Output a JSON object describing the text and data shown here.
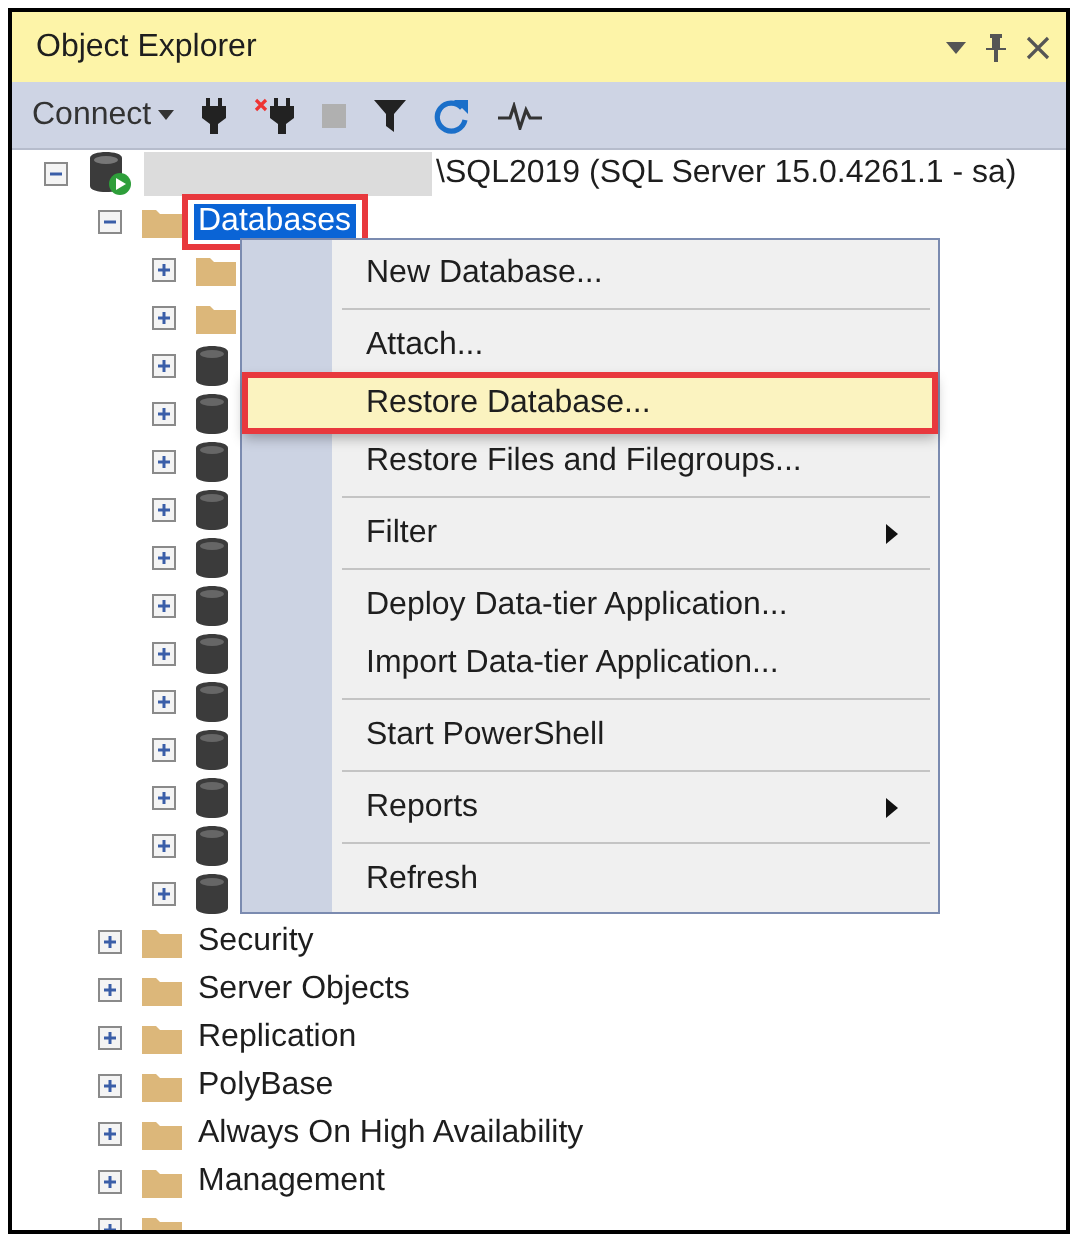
{
  "window": {
    "title": "Object Explorer"
  },
  "toolbar": {
    "connect": "Connect",
    "stop_disabled": true
  },
  "tree": [
    {
      "kind": "server",
      "label": "\\SQL2019 (SQL Server 15.0.4261.1 - sa)",
      "redacted": true,
      "expanded": true,
      "selected": false,
      "children": [
        {
          "kind": "folder",
          "label": "Databases",
          "expanded": true,
          "selected": true,
          "annotated": true,
          "children": [
            {
              "kind": "folder",
              "expanded": false
            },
            {
              "kind": "folder",
              "expanded": false
            },
            {
              "kind": "database",
              "expanded": false
            },
            {
              "kind": "database",
              "expanded": false
            },
            {
              "kind": "database",
              "expanded": false
            },
            {
              "kind": "database",
              "expanded": false
            },
            {
              "kind": "database",
              "expanded": false
            },
            {
              "kind": "database",
              "expanded": false
            },
            {
              "kind": "database",
              "expanded": false
            },
            {
              "kind": "database",
              "expanded": false
            },
            {
              "kind": "database",
              "expanded": false
            },
            {
              "kind": "database",
              "expanded": false
            },
            {
              "kind": "database",
              "expanded": false
            },
            {
              "kind": "database",
              "expanded": false
            }
          ]
        },
        {
          "kind": "folder",
          "label": "Security",
          "expanded": false,
          "selected": false
        },
        {
          "kind": "folder",
          "label": "Server Objects",
          "expanded": false,
          "selected": false
        },
        {
          "kind": "folder",
          "label": "Replication",
          "expanded": false,
          "selected": false
        },
        {
          "kind": "folder",
          "label": "PolyBase",
          "expanded": false,
          "selected": false
        },
        {
          "kind": "folder",
          "label": "Always On High Availability",
          "expanded": false,
          "selected": false
        },
        {
          "kind": "folder",
          "label": "Management",
          "expanded": false,
          "selected": false
        },
        {
          "kind": "folder",
          "expanded": false
        }
      ]
    }
  ],
  "context_menu": [
    {
      "kind": "item",
      "label": "New Database...",
      "selected": false,
      "submenu": false
    },
    {
      "kind": "separator"
    },
    {
      "kind": "item",
      "label": "Attach...",
      "selected": false,
      "submenu": false
    },
    {
      "kind": "item",
      "label": "Restore Database...",
      "selected": true,
      "submenu": false,
      "annotated": true
    },
    {
      "kind": "item",
      "label": "Restore Files and Filegroups...",
      "selected": false,
      "submenu": false
    },
    {
      "kind": "separator"
    },
    {
      "kind": "item",
      "label": "Filter",
      "selected": false,
      "submenu": true
    },
    {
      "kind": "separator"
    },
    {
      "kind": "item",
      "label": "Deploy Data-tier Application...",
      "selected": false,
      "submenu": false
    },
    {
      "kind": "item",
      "label": "Import Data-tier Application...",
      "selected": false,
      "submenu": false
    },
    {
      "kind": "separator"
    },
    {
      "kind": "item",
      "label": "Start PowerShell",
      "selected": false,
      "submenu": false
    },
    {
      "kind": "separator"
    },
    {
      "kind": "item",
      "label": "Reports",
      "selected": false,
      "submenu": true
    },
    {
      "kind": "separator"
    },
    {
      "kind": "item",
      "label": "Refresh",
      "selected": false,
      "submenu": false
    }
  ]
}
